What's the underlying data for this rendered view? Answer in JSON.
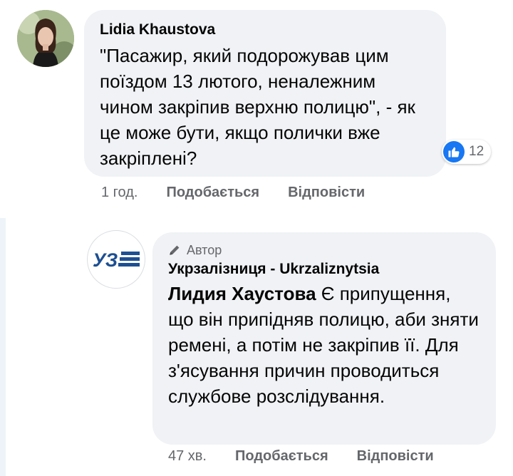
{
  "comment": {
    "author": "Lidia  Khaustova",
    "text": "\"Пасажир, який подорожував цим поїздом 13 лютого, неналежним чином закріпив верхню полицю\", - як це може бути, якщо полички вже закріплені?",
    "reaction_count": "12",
    "time": "1 год.",
    "like_label": "Подобається",
    "reply_label": "Відповісти"
  },
  "reply": {
    "badge": "Автор",
    "author": "Укрзалізниця - Ukrzaliznytsia",
    "mention": "Лидия Хаустова",
    "text": " Є припущення, що він припідняв полицю, аби зняти ремені, а потім не закріпив її. Для з'ясування причин проводиться службове розслідування.",
    "time": "47 хв.",
    "like_label": "Подобається",
    "reply_label": "Відповісти"
  },
  "icons": {
    "like": "thumbs-up-icon",
    "badge": "pencil-icon",
    "logo": "uz-logo"
  },
  "colors": {
    "bubble": "#f0f2f5",
    "like_blue": "#1877f2",
    "logo_blue": "#1d4f91",
    "muted": "#65676b"
  }
}
